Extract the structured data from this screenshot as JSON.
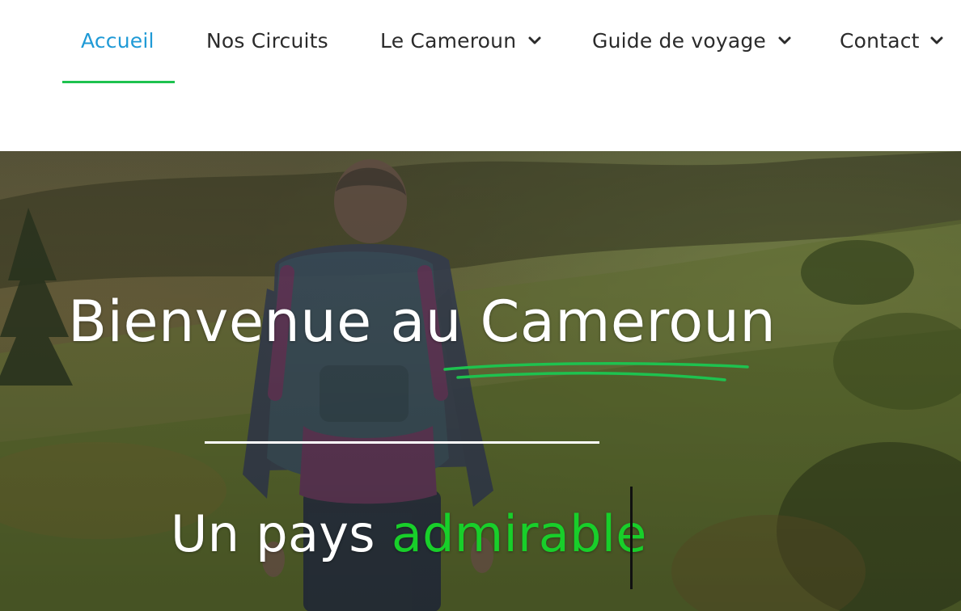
{
  "nav": {
    "items": [
      {
        "label": "Accueil",
        "active": true,
        "dropdown": false
      },
      {
        "label": "Nos Circuits",
        "active": false,
        "dropdown": false
      },
      {
        "label": "Le Cameroun",
        "active": false,
        "dropdown": true
      },
      {
        "label": "Guide de voyage",
        "active": false,
        "dropdown": true
      },
      {
        "label": "Contact",
        "active": false,
        "dropdown": true
      }
    ],
    "dropdown_icon": "chevron-down-icon"
  },
  "hero": {
    "title": "Bienvenue au Cameroun",
    "subtitle_prefix": "Un pays",
    "subtitle_highlight": "admirable",
    "background": "hiker-with-backpack-on-green-hillside"
  },
  "colors": {
    "nav_active": "#1f9ad6",
    "nav_text": "#2b2b2b",
    "accent_green": "#1ec24f",
    "highlight_green": "#18cf2a"
  }
}
